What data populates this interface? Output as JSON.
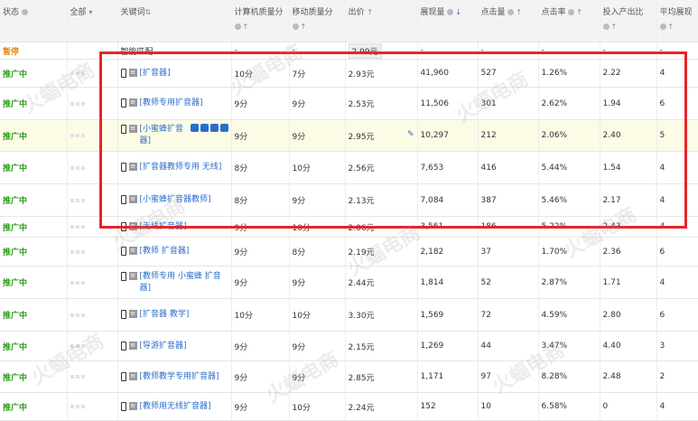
{
  "header": {
    "status": "状态",
    "all": "全部",
    "keyword": "关键词",
    "pc_quality": "计算机质量分",
    "mobile_quality": "移动质量分",
    "bid": "出价",
    "impressions": "展现量",
    "clicks": "点击量",
    "ctr": "点击率",
    "roi": "投入产出比",
    "avg_rank": "平均展现"
  },
  "smart_row": {
    "status": "暂停",
    "keyword": "智能匹配",
    "pc": "-",
    "mobile": "-",
    "bid": "2.99元",
    "impressions": "-",
    "clicks": "-",
    "ctr": "-",
    "roi": "-",
    "avg": "-"
  },
  "rows": [
    {
      "status": "推广中",
      "keyword": "[扩音器]",
      "pc": "10分",
      "mobile": "7分",
      "bid": "2.93元",
      "impressions": "41,960",
      "clicks": "527",
      "ctr": "1.26%",
      "roi": "2.22",
      "avg": "4"
    },
    {
      "status": "推广中",
      "keyword": "[教师专用扩音器]",
      "pc": "9分",
      "mobile": "9分",
      "bid": "2.53元",
      "impressions": "11,506",
      "clicks": "301",
      "ctr": "2.62%",
      "roi": "1.94",
      "avg": "6"
    },
    {
      "status": "推广中",
      "keyword": "[小蜜蜂扩音器]",
      "pc": "9分",
      "mobile": "9分",
      "bid": "2.95元",
      "impressions": "10,297",
      "clicks": "212",
      "ctr": "2.06%",
      "roi": "2.40",
      "avg": "5"
    },
    {
      "status": "推广中",
      "keyword": "[扩音器教师专用 无线]",
      "pc": "8分",
      "mobile": "10分",
      "bid": "2.56元",
      "impressions": "7,653",
      "clicks": "416",
      "ctr": "5.44%",
      "roi": "1.54",
      "avg": "4"
    },
    {
      "status": "推广中",
      "keyword": "[小蜜蜂扩音器教师]",
      "pc": "8分",
      "mobile": "9分",
      "bid": "2.13元",
      "impressions": "7,084",
      "clicks": "387",
      "ctr": "5.46%",
      "roi": "2.17",
      "avg": "4"
    },
    {
      "status": "推广中",
      "keyword": "[无线扩音器]",
      "pc": "9分",
      "mobile": "10分",
      "bid": "2.06元",
      "impressions": "3,561",
      "clicks": "186",
      "ctr": "5.22%",
      "roi": "2.43",
      "avg": "4"
    },
    {
      "status": "推广中",
      "keyword": "[教师 扩音器]",
      "pc": "9分",
      "mobile": "8分",
      "bid": "2.19元",
      "impressions": "2,182",
      "clicks": "37",
      "ctr": "1.70%",
      "roi": "2.36",
      "avg": "6"
    },
    {
      "status": "推广中",
      "keyword": "[教师专用 小蜜蜂 扩音器]",
      "pc": "9分",
      "mobile": "9分",
      "bid": "2.44元",
      "impressions": "1,814",
      "clicks": "52",
      "ctr": "2.87%",
      "roi": "1.71",
      "avg": "4"
    },
    {
      "status": "推广中",
      "keyword": "[扩音器 教学]",
      "pc": "10分",
      "mobile": "10分",
      "bid": "3.30元",
      "impressions": "1,569",
      "clicks": "72",
      "ctr": "4.59%",
      "roi": "2.80",
      "avg": "6"
    },
    {
      "status": "推广中",
      "keyword": "[导游扩音器]",
      "pc": "9分",
      "mobile": "9分",
      "bid": "2.15元",
      "impressions": "1,269",
      "clicks": "44",
      "ctr": "3.47%",
      "roi": "4.40",
      "avg": "3"
    },
    {
      "status": "推广中",
      "keyword": "[教师教学专用扩音器]",
      "pc": "9分",
      "mobile": "9分",
      "bid": "2.85元",
      "impressions": "1,171",
      "clicks": "97",
      "ctr": "8.28%",
      "roi": "2.48",
      "avg": "2"
    },
    {
      "status": "推广中",
      "keyword": "[教师用无线扩音器]",
      "pc": "9分",
      "mobile": "10分",
      "bid": "2.24元",
      "impressions": "152",
      "clicks": "10",
      "ctr": "6.58%",
      "roi": "0",
      "avg": "4"
    }
  ]
}
